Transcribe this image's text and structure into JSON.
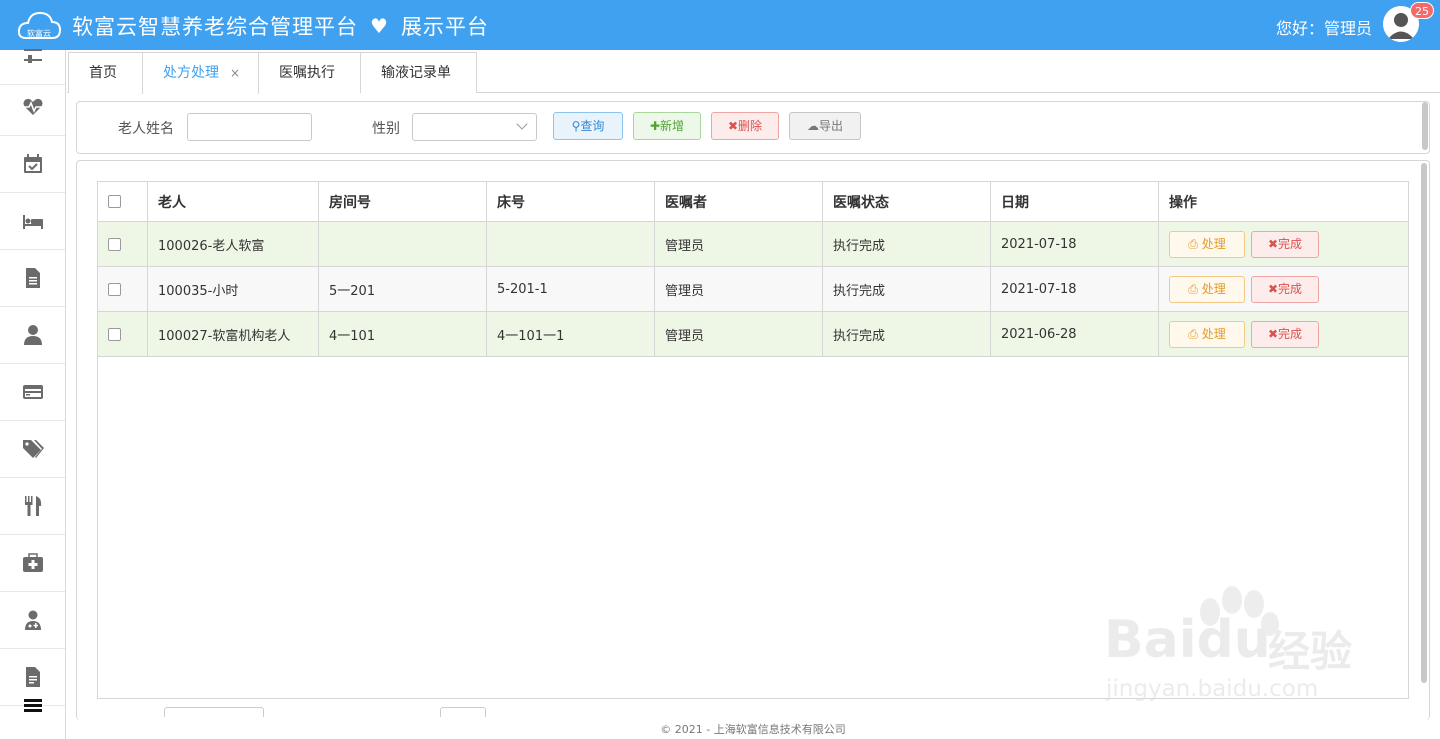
{
  "header": {
    "logo_text": "软富云",
    "title": "软富云智慧养老综合管理平台",
    "subtitle": "展示平台",
    "greeting": "您好：管理员",
    "badge_count": "25",
    "bg_color": "#3fa1f0"
  },
  "sidebar": {
    "icons": [
      "sliders-icon",
      "heartbeat-icon",
      "calendar-check-icon",
      "bed-icon",
      "file-icon",
      "user-icon",
      "credit-card-icon",
      "tags-icon",
      "cutlery-icon",
      "medkit-icon",
      "user-md-icon",
      "file-text-icon"
    ],
    "menu_icon": "hamburger-icon"
  },
  "tabs": [
    {
      "label": "首页"
    },
    {
      "label": "处方处理",
      "active": true,
      "close": "×"
    },
    {
      "label": "医嘱执行"
    },
    {
      "label": "输液记录单"
    }
  ],
  "search": {
    "name_label": "老人姓名",
    "name_value": "",
    "gender_label": "性别",
    "gender_value": "",
    "query_label": "查询",
    "add_label": "新增",
    "delete_label": "删除",
    "export_label": "导出"
  },
  "table": {
    "columns": [
      "老人",
      "房间号",
      "床号",
      "医嘱者",
      "医嘱状态",
      "日期",
      "操作"
    ],
    "rows": [
      {
        "elder": "100026-老人软富",
        "room": "",
        "bed": "",
        "doctor": "管理员",
        "status": "执行完成",
        "date": "2021-07-18",
        "handle": "处理",
        "done": "完成"
      },
      {
        "elder": "100035-小时",
        "room": "5一201",
        "bed": "5-201-1",
        "doctor": "管理员",
        "status": "执行完成",
        "date": "2021-07-18",
        "handle": "处理",
        "done": "完成"
      },
      {
        "elder": "100027-软富机构老人",
        "room": "4一101",
        "bed": "4一101一1",
        "doctor": "管理员",
        "status": "执行完成",
        "date": "2021-06-28",
        "handle": "处理",
        "done": "完成"
      }
    ]
  },
  "footer": {
    "text": "© 2021 - 上海软富信息技术有限公司"
  },
  "watermark": {
    "brand": "Baidu",
    "suffix": "经验",
    "url": "jingyan.baidu.com"
  }
}
